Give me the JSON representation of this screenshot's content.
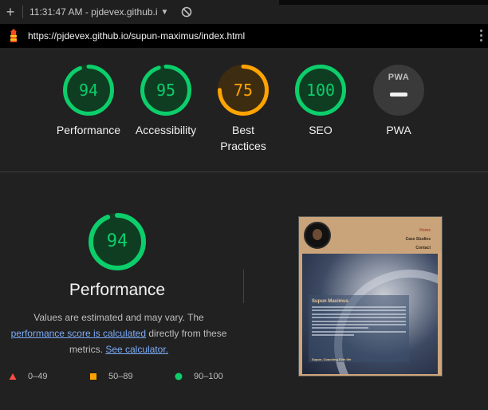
{
  "toolbar": {
    "plus_glyph": "+",
    "tab_label": "11:31:47 AM - pjdevex.github.i",
    "dropdown_glyph": "▼"
  },
  "urlbar": {
    "url": "https://pjdevex.github.io/supun-maximus/index.html"
  },
  "colors": {
    "pass": "#0cce6b",
    "average": "#ffa400",
    "fail": "#ff4e42",
    "pwa_gray": "#9e9e9e"
  },
  "gauges": [
    {
      "score": "94",
      "label": "Performance",
      "status": "pass",
      "fraction": 0.94
    },
    {
      "score": "95",
      "label": "Accessibility",
      "status": "pass",
      "fraction": 0.95
    },
    {
      "score": "75",
      "label_line1": "Best",
      "label_line2": "Practices",
      "status": "average",
      "fraction": 0.75
    },
    {
      "score": "100",
      "label": "SEO",
      "status": "pass",
      "fraction": 1.0
    },
    {
      "badge": "PWA",
      "label": "PWA",
      "status": "na"
    }
  ],
  "performance": {
    "score": "94",
    "fraction": 0.94,
    "title": "Performance",
    "desc_prefix": "Values are estimated and may vary. The",
    "desc_link": "performance score is calculated",
    "desc_mid": "directly from these metrics.",
    "desc_link2": "See calculator."
  },
  "legend": [
    {
      "range": "0–49",
      "shape": "triangle",
      "color": "#ff4e42"
    },
    {
      "range": "50–89",
      "shape": "square",
      "color": "#ffa400"
    },
    {
      "range": "90–100",
      "shape": "circle",
      "color": "#0cce6b"
    }
  ],
  "screenshot": {
    "nav": [
      "Home",
      "Case Studies",
      "Contact"
    ],
    "name": "Supun Maximus",
    "footer": "Supun, Coaching Elite life"
  }
}
